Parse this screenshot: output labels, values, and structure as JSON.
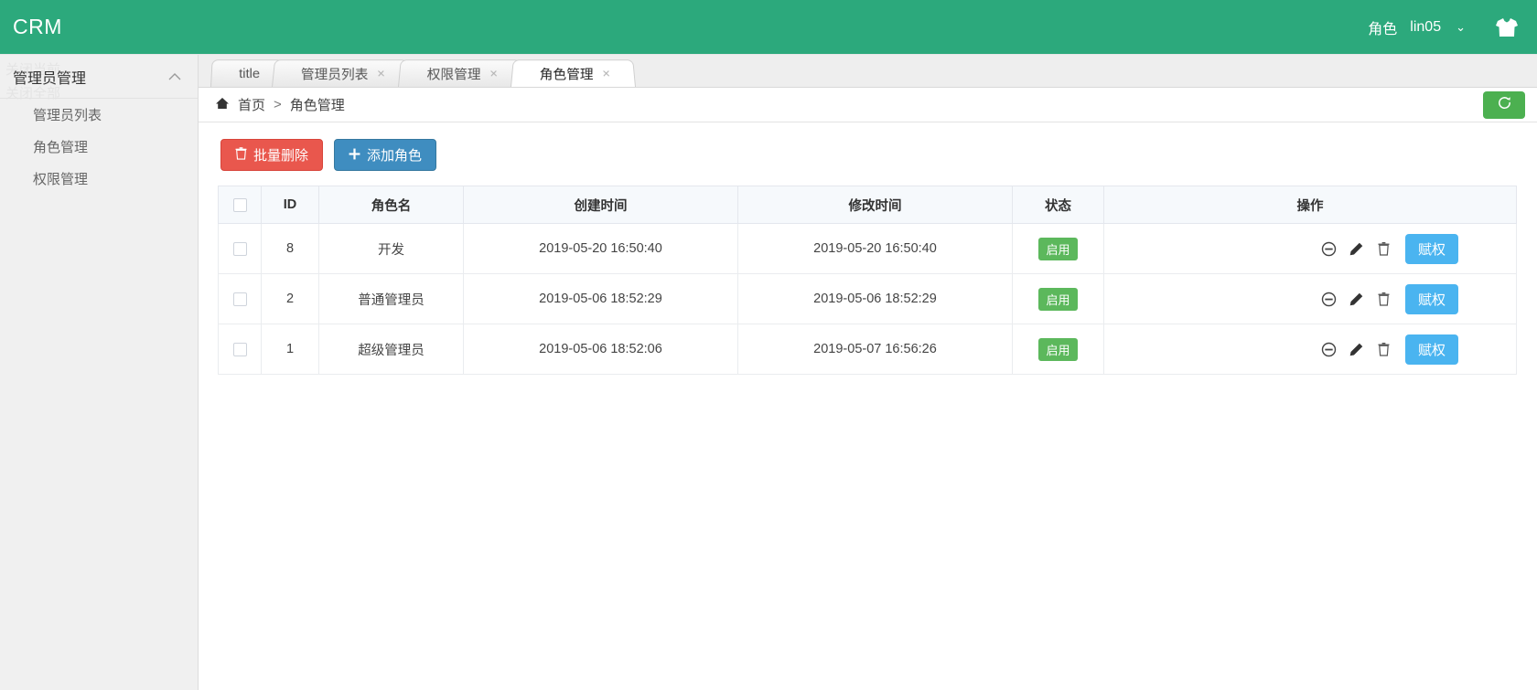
{
  "header": {
    "brand": "CRM",
    "role_label": "角色",
    "username": "lin05",
    "caret": "⌄",
    "avatar_icon": "shirt-icon"
  },
  "sidebar": {
    "ghost_text_1": "关闭当前",
    "ghost_text_2": "关闭全部",
    "group_title": "管理员管理",
    "collapse_chevron": "⌃",
    "items": [
      {
        "label": "管理员列表"
      },
      {
        "label": "角色管理"
      },
      {
        "label": "权限管理"
      }
    ]
  },
  "tabs": [
    {
      "label": "title",
      "closable": false,
      "active": false
    },
    {
      "label": "管理员列表",
      "closable": true,
      "active": false
    },
    {
      "label": "权限管理",
      "closable": true,
      "active": false
    },
    {
      "label": "角色管理",
      "closable": true,
      "active": true
    }
  ],
  "tab_close_glyph": "×",
  "breadcrumb": {
    "home_icon": "home-icon",
    "home_label": "首页",
    "separator": ">",
    "current": "角色管理"
  },
  "refresh_button": {
    "icon": "refresh-icon",
    "title": "刷新"
  },
  "toolbar": {
    "bulk_delete_label": "批量删除",
    "bulk_delete_icon": "trash-icon",
    "add_role_label": "添加角色",
    "add_role_icon": "plus-icon"
  },
  "table": {
    "columns": [
      "",
      "ID",
      "角色名",
      "创建时间",
      "修改时间",
      "状态",
      "操作"
    ],
    "rows": [
      {
        "id": "8",
        "name": "开发",
        "created": "2019-05-20 16:50:40",
        "modified": "2019-05-20 16:50:40",
        "status": "启用",
        "grant_label": "赋权"
      },
      {
        "id": "2",
        "name": "普通管理员",
        "created": "2019-05-06 18:52:29",
        "modified": "2019-05-06 18:52:29",
        "status": "启用",
        "grant_label": "赋权"
      },
      {
        "id": "1",
        "name": "超级管理员",
        "created": "2019-05-06 18:52:06",
        "modified": "2019-05-07 16:56:26",
        "status": "启用",
        "grant_label": "赋权"
      }
    ],
    "row_action_icons": [
      "ban-icon",
      "edit-pencil-icon",
      "delete-trash-icon"
    ]
  },
  "colors": {
    "header_green": "#2ca97c",
    "refresh_green": "#4cb050",
    "badge_green": "#5cb85c",
    "danger_red": "#e9574d",
    "primary_blue": "#3f8dc0",
    "grant_blue": "#4ab4f0"
  }
}
